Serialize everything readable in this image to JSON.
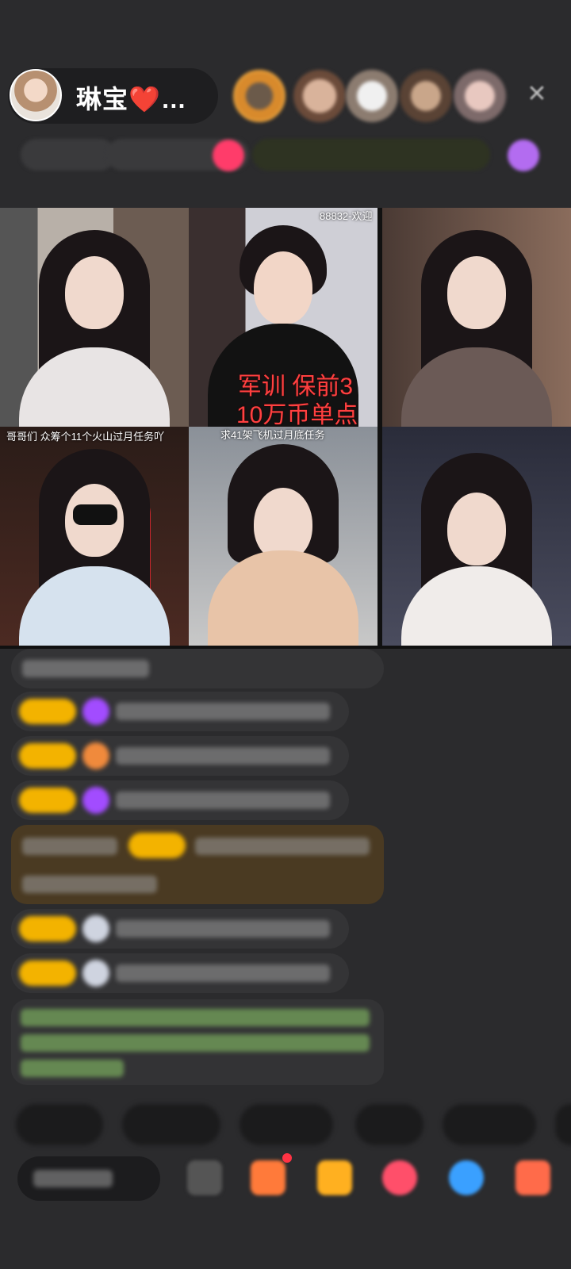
{
  "header": {
    "host_name": "琳宝❤️…",
    "close_icon": "close-icon"
  },
  "grid": {
    "tile2_caption_top": "88832-欢迎",
    "tile2_overlay_line1": "军训 保前3",
    "tile2_overlay_line2": "10万币单点",
    "tile4_caption": "哥哥们 众筹个11个火山过月任务吖",
    "tile5_caption": "求41架飞机过月底任务"
  },
  "colors": {
    "background": "#2b2b2d",
    "badge_gold": "#f3b300",
    "heart_purple": "#a24cff",
    "overlay_red": "#ff4040"
  }
}
